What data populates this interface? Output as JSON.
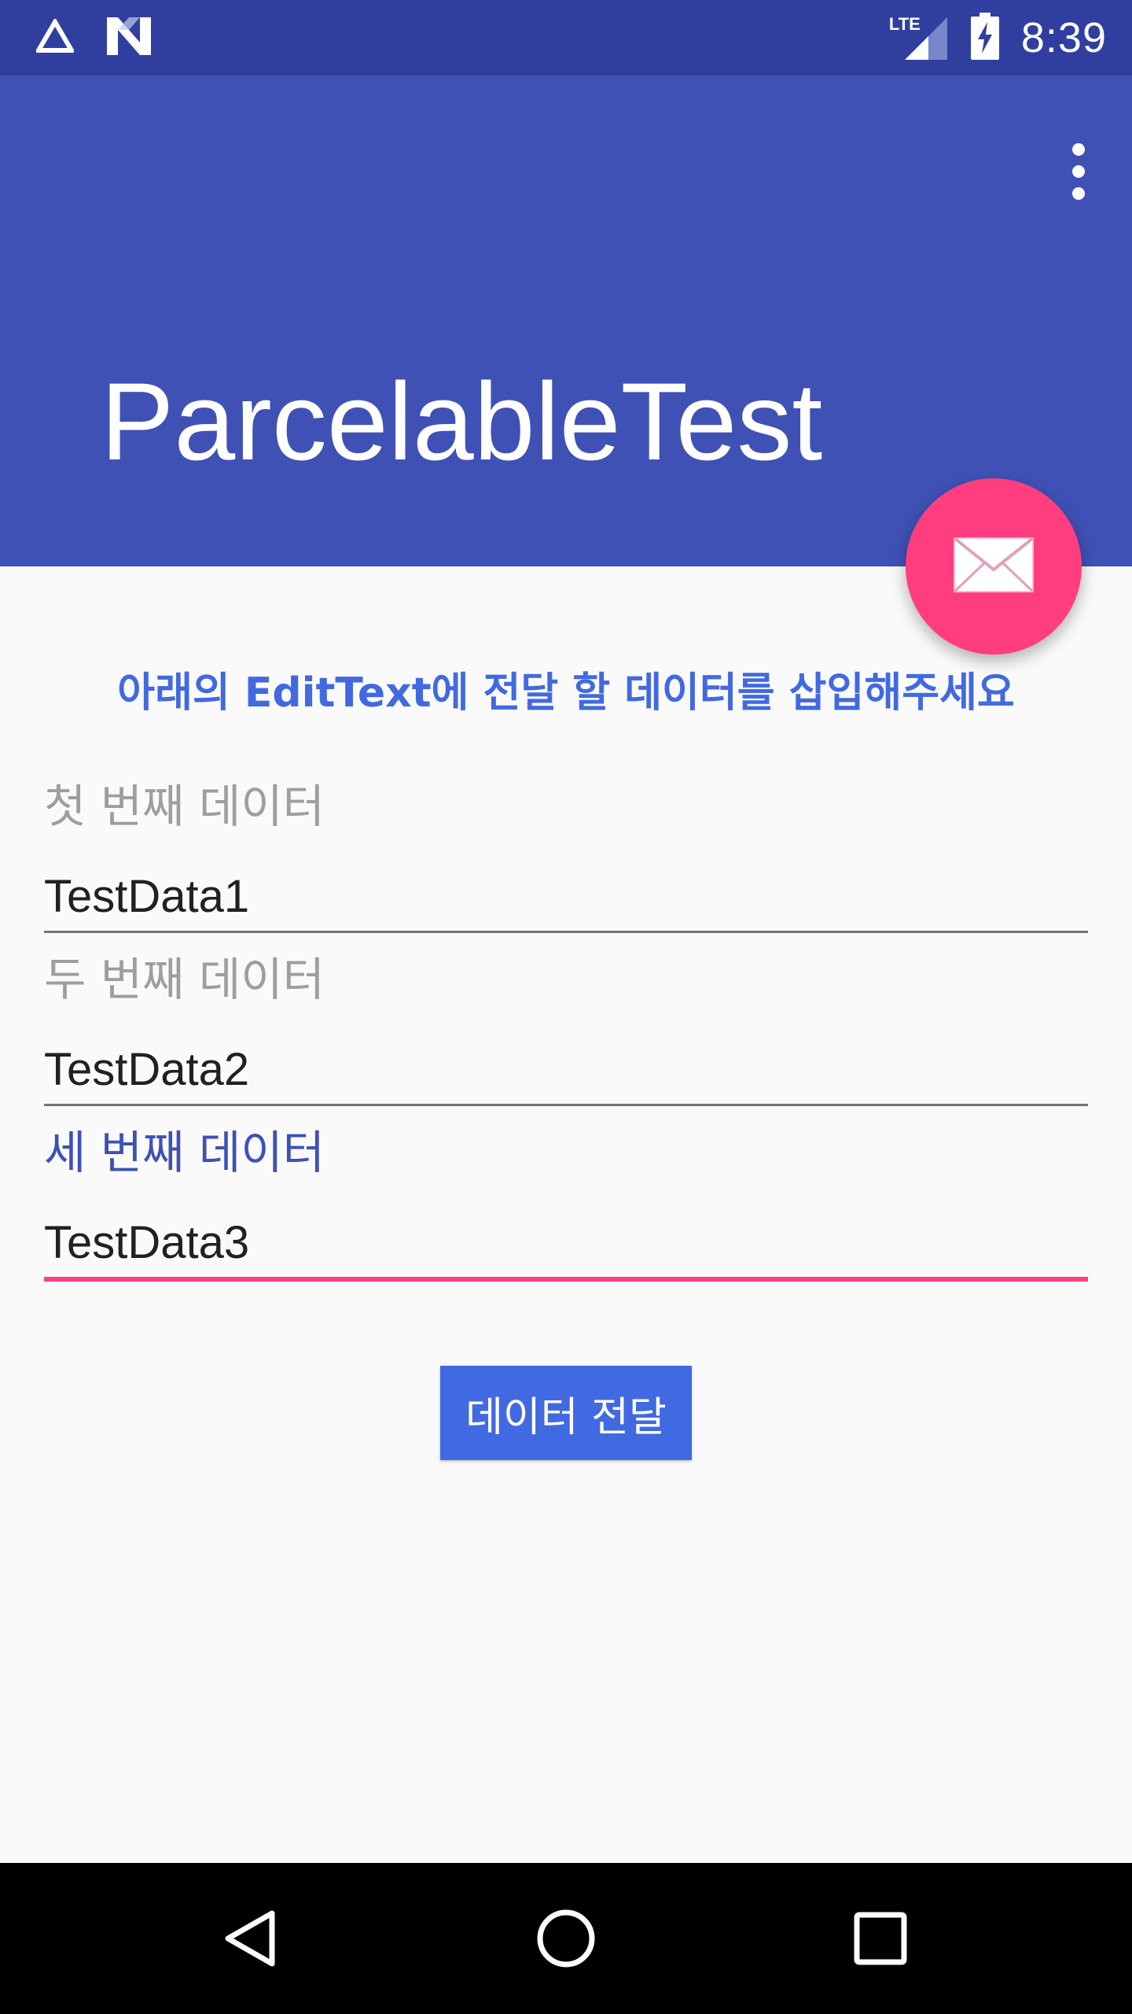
{
  "status_bar": {
    "time": "8:39",
    "network": "LTE",
    "icons": [
      "warning-triangle-icon",
      "n-logo-icon",
      "lte-signal-icon",
      "battery-charging-icon"
    ]
  },
  "app_bar": {
    "title": "ParcelableTest",
    "overflow_icon": "more-vert-icon",
    "color": "#3f51b5"
  },
  "fab": {
    "icon": "email-icon",
    "color": "#ff3d7f"
  },
  "content": {
    "instruction": "아래의 EditText에 전달 할 데이터를 삽입해주세요",
    "fields": [
      {
        "label": "첫 번째 데이터",
        "value": "TestData1",
        "focused": false
      },
      {
        "label": "두 번째 데이터",
        "value": "TestData2",
        "focused": false
      },
      {
        "label": "세 번째 데이터",
        "value": "TestData3",
        "focused": true
      }
    ],
    "button_label": "데이터 전달"
  },
  "colors": {
    "primary": "#3f51b5",
    "primary_dark": "#303f9f",
    "accent": "#ff4081",
    "button": "#4169e1"
  },
  "nav_bar": {
    "icons": [
      "back-icon",
      "home-icon",
      "recents-icon"
    ]
  }
}
